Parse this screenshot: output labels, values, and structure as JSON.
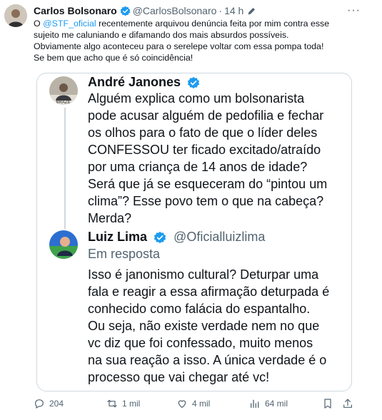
{
  "tweet": {
    "author_name": "Carlos Bolsonaro",
    "author_handle": "@CarlosBolsonaro",
    "separator": "·",
    "time": "14 h",
    "more": "···",
    "text_pre": "O ",
    "mention": "@STF_oficial",
    "text_line1_rest": " recentemente arquivou denúncia feita por mim contra esse",
    "text_line2": "sujeito me caluniando e difamando dos mais absurdos possíveis.",
    "text_line3": "Obviamente algo aconteceu para o serelepe voltar com essa pompa toda!",
    "text_line4": "Se bem que acho que é só coincidência!"
  },
  "quote": {
    "author_name": "André Janones",
    "text": [
      "Alguém explica como um bolsonarista",
      "pode acusar alguém de pedofilia e fechar",
      "os olhos para o fato de que o líder deles",
      "CONFESSOU ter ficado excitado/atraído",
      "por uma criança de 14 anos de idade?",
      "Será que já se esqueceram do “pintou um",
      "clima”? Esse povo tem o que na cabeça?",
      "Merda?"
    ],
    "reply_author_name": "Luiz Lima",
    "reply_author_handle": "@Oficialluizlima",
    "reply_label": "Em resposta",
    "reply_text": [
      "Isso é janonismo cultural? Deturpar uma",
      "fala e reagir a essa afirmação deturpada é",
      "conhecido como falácia do espantalho.",
      "Ou seja, não existe verdade nem no que",
      "vc diz que foi confessado, muito menos",
      "na sua reação a isso. A única verdade é o",
      "processo que vai chegar até vc!"
    ]
  },
  "actions": {
    "replies": "204",
    "retweets": "1 mil",
    "likes": "4 mil",
    "views": "64 mil"
  },
  "colors": {
    "accent": "#1d9bf0",
    "text": "#0f1419",
    "muted": "#536471",
    "border": "#cfd9de"
  }
}
